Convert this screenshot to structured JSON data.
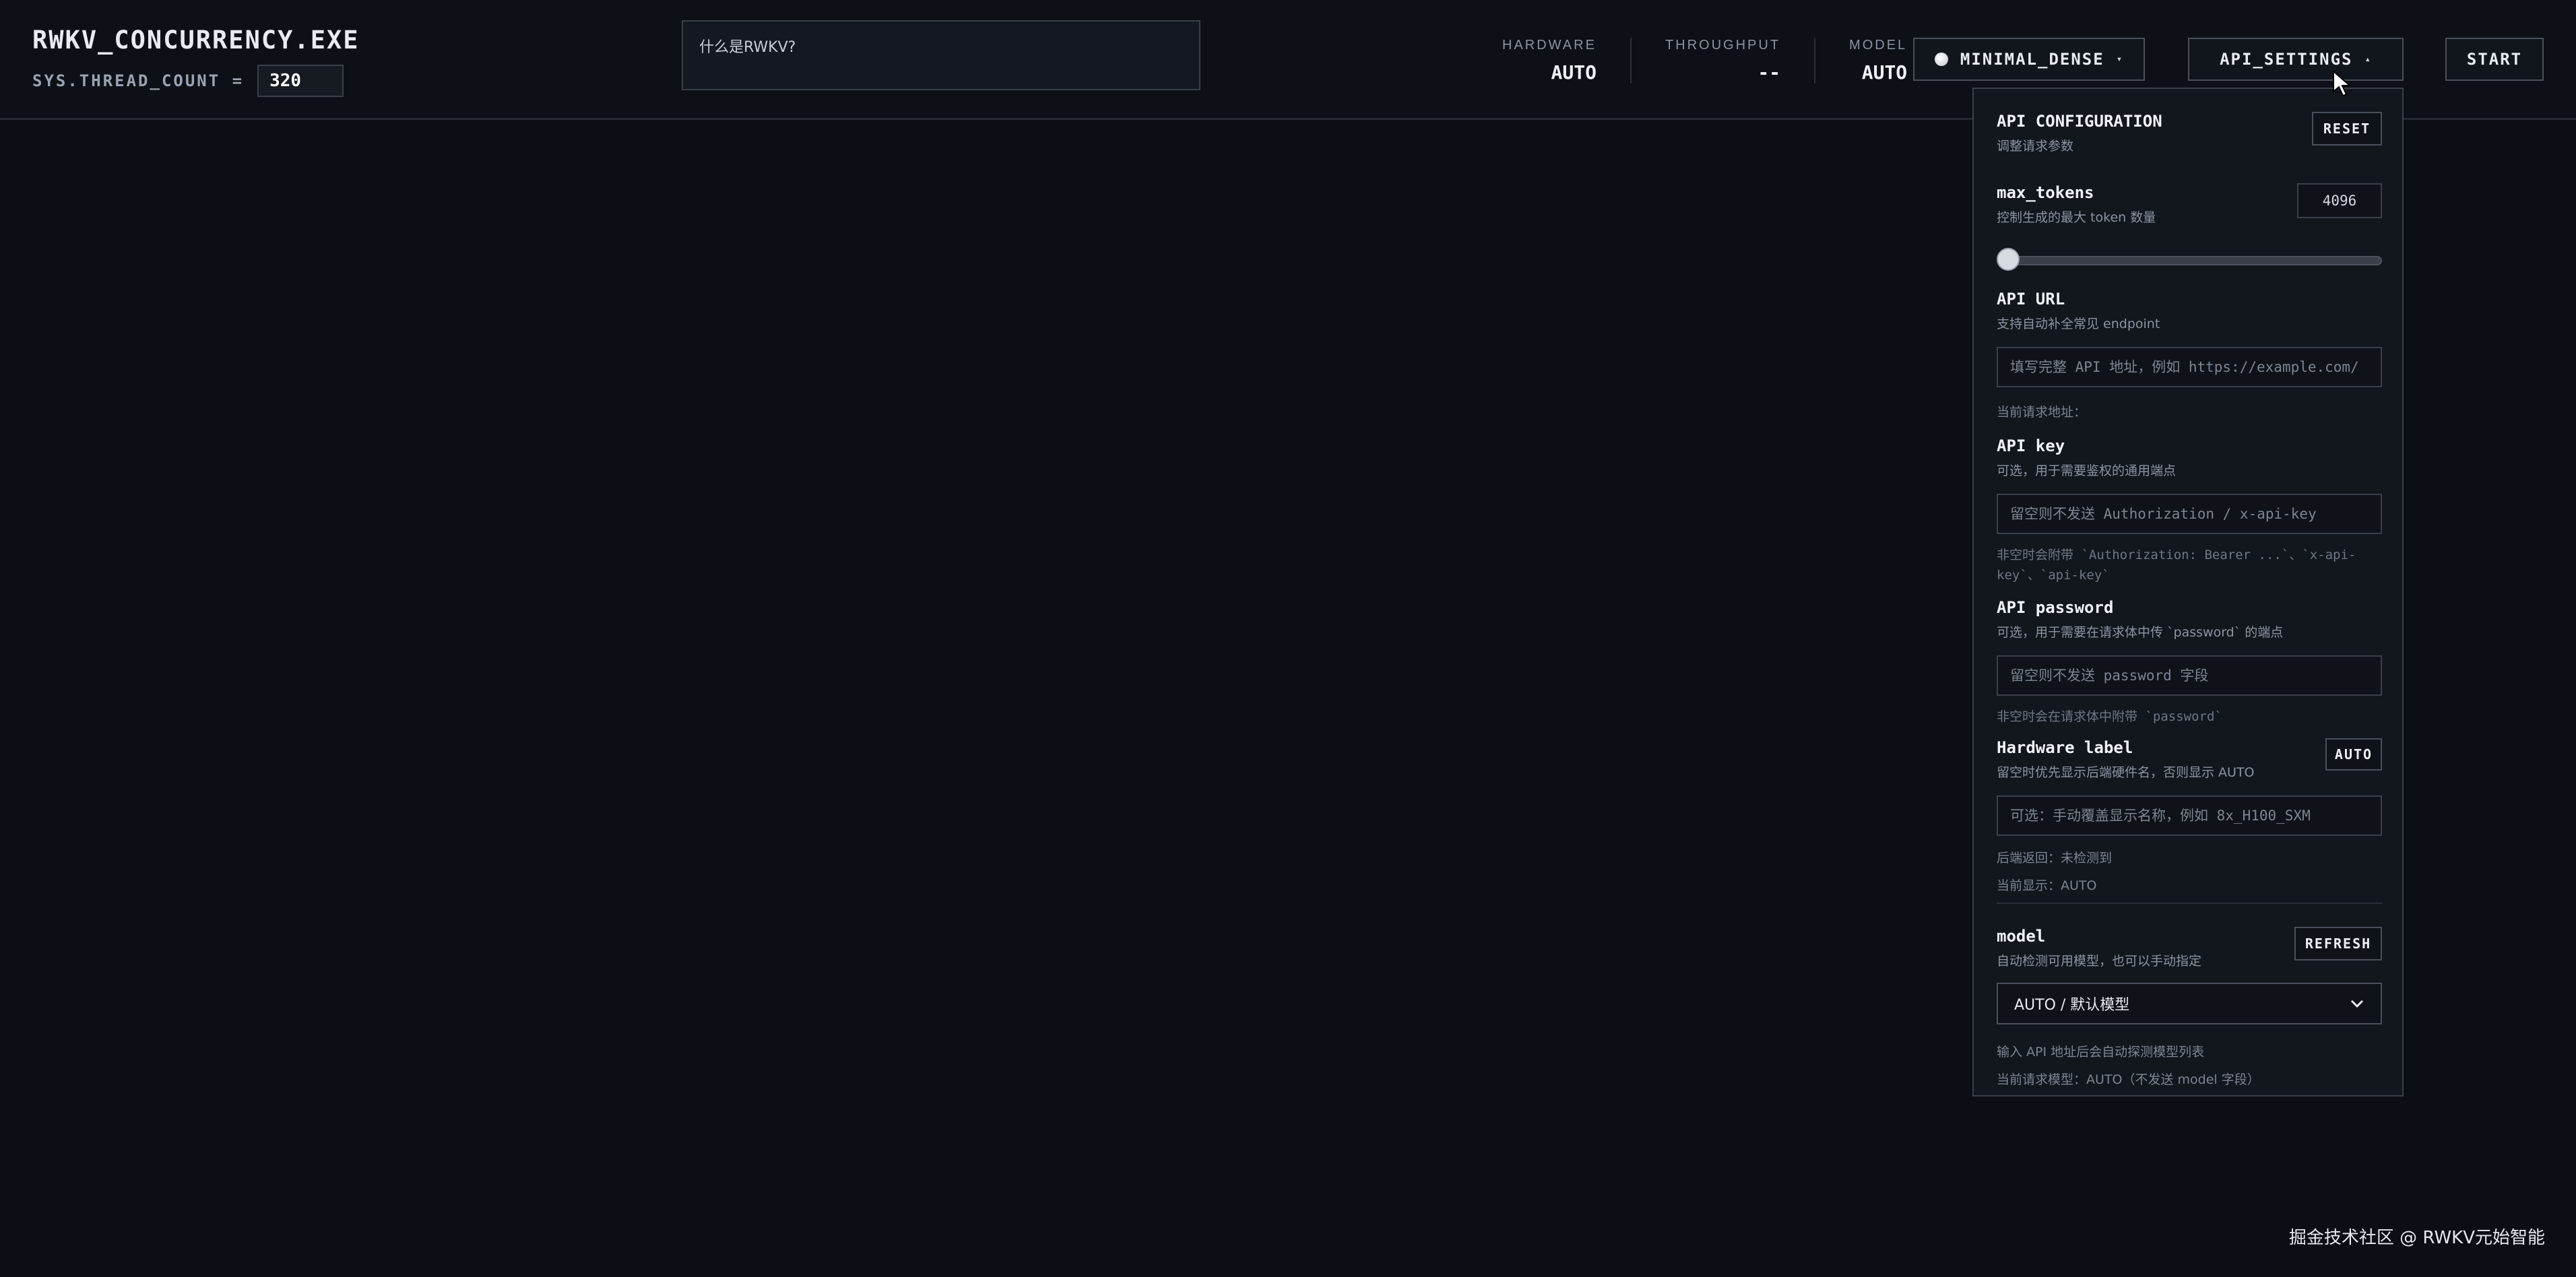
{
  "header": {
    "title": "RWKV_CONCURRENCY.EXE",
    "thread_label": "SYS.THREAD_COUNT =",
    "thread_value": "320",
    "query_value": "什么是RWKV?",
    "stats": [
      {
        "label": "HARDWARE",
        "value": "AUTO"
      },
      {
        "label": "THROUGHPUT",
        "value": "--"
      },
      {
        "label": "MODEL",
        "value": "AUTO"
      }
    ],
    "theme_button": "MINIMAL_DENSE",
    "settings_button": "API_SETTINGS",
    "start_button": "START"
  },
  "panel": {
    "title": "API CONFIGURATION",
    "subtitle": "调整请求参数",
    "reset": "RESET",
    "max_tokens": {
      "label": "max_tokens",
      "desc": "控制生成的最大 token 数量",
      "value": "4096",
      "slider_fraction": 0.0
    },
    "api_url": {
      "label": "API URL",
      "desc": "支持自动补全常见 endpoint",
      "placeholder": "填写完整 API 地址，例如 https://example.com/",
      "current": "当前请求地址："
    },
    "api_key": {
      "label": "API key",
      "desc": "可选，用于需要鉴权的通用端点",
      "placeholder": "留空则不发送 Authorization / x-api-key",
      "note": "非空时会附带 `Authorization: Bearer ...`、`x-api-key`、`api-key`"
    },
    "api_password": {
      "label": "API password",
      "desc": "可选，用于需要在请求体中传 `password` 的端点",
      "placeholder": "留空则不发送 password 字段",
      "note": "非空时会在请求体中附带 `password`"
    },
    "hardware": {
      "label": "Hardware label",
      "desc": "留空时优先显示后端硬件名，否则显示 AUTO",
      "button": "AUTO",
      "placeholder": "可选：手动覆盖显示名称，例如 8x_H100_SXM",
      "backend": "后端返回：未检测到",
      "current": "当前显示：AUTO"
    },
    "model": {
      "label": "model",
      "desc": "自动检测可用模型，也可以手动指定",
      "refresh": "REFRESH",
      "selected": "AUTO / 默认模型",
      "note1": "输入 API 地址后会自动探测模型列表",
      "note2": "当前请求模型：AUTO（不发送 model 字段）"
    }
  },
  "watermark": "掘金技术社区 @ RWKV元始智能",
  "icons": {
    "theme_dot": "radio-dot-icon",
    "caret_down": "caret-down-icon",
    "caret_up": "caret-up-icon",
    "chevron": "chevron-down-icon",
    "cursor": "mouse-cursor-icon"
  }
}
